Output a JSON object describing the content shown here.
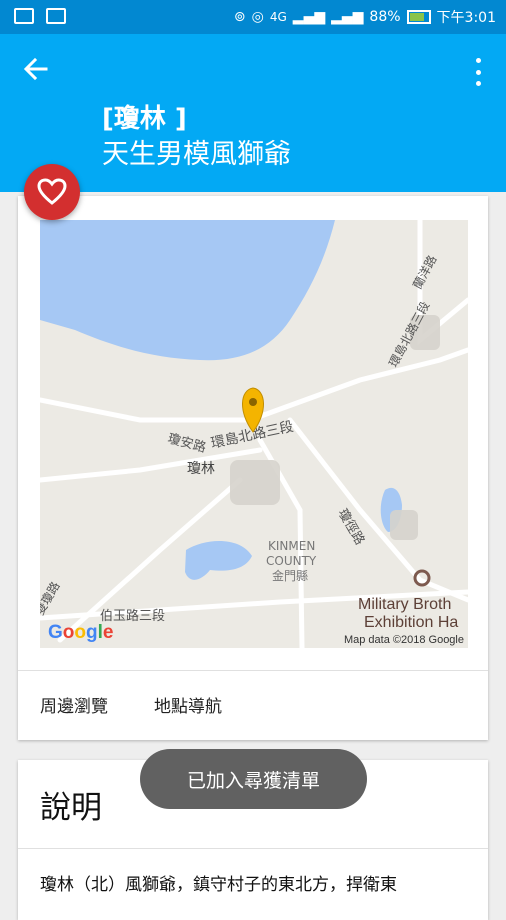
{
  "status_bar": {
    "signal_label": "4G",
    "battery": "88%",
    "time": "下午3:01"
  },
  "app_bar": {
    "title_line1": "[瓊林 ]",
    "title_line2": "天生男模風獅爺"
  },
  "map": {
    "place_labels": {
      "qionglin": "瓊林",
      "road_huandao_north": "環島北路三段",
      "road_huandao_north_ne": "環島北路三段",
      "road_qiongan": "瓊安路",
      "road_qiongxu": "瓊徑路",
      "road_shuangli": "雙瓊路",
      "road_boyu": "伯玉路三段",
      "road_lanxi": "蘭洋路",
      "county_en_1": "KINMEN",
      "county_en_2": "COUNTY",
      "county_zh": "金門縣",
      "poi_1": "Military Broth",
      "poi_2": "Exhibition Ha"
    },
    "credit": "Map data ©2018 Google",
    "logo": [
      "G",
      "o",
      "o",
      "g",
      "l",
      "e"
    ]
  },
  "actions": {
    "browse": "周邊瀏覽",
    "navigate": "地點導航"
  },
  "description": {
    "heading": "說明",
    "body": "瓊林（北）風獅爺，鎮守村子的東北方，捍衛東"
  },
  "toast": "已加入尋獲清單",
  "colors": {
    "status_bar": "#0288d1",
    "app_bar": "#03a9f4",
    "fab": "#d32f2f",
    "water": "#a6c8f4",
    "pin": "#f4b400"
  }
}
